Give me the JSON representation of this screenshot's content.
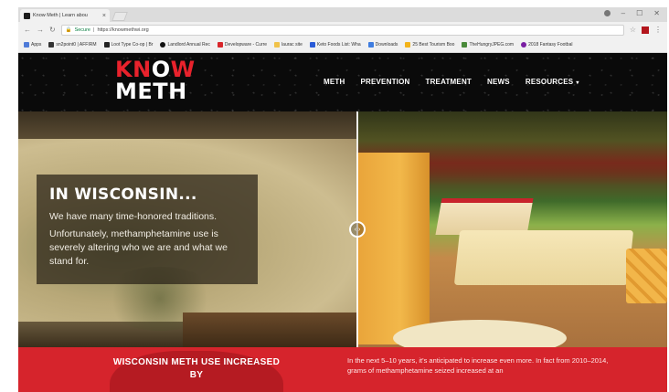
{
  "browser": {
    "tab_title": "Know Meth | Learn abou",
    "tab_close": "×",
    "url_secure": "Secure",
    "url": "https://knowmethwi.org",
    "window_controls": [
      "–",
      "☐",
      "✕"
    ],
    "bookmarks": [
      {
        "label": "Apps",
        "icon": "apps-grid-icon",
        "color": "#4f7bd8"
      },
      {
        "label": "sn2point0 | AFFIRM",
        "icon": "bookmark-site-icon",
        "color": "#333333"
      },
      {
        "label": "Loot Type Co-op | Br",
        "icon": "bookmark-site-icon",
        "color": "#222222"
      },
      {
        "label": "Landlord Annual Rec",
        "icon": "bookmark-site-icon",
        "color": "#111111"
      },
      {
        "label": "Developware - Curre",
        "icon": "bookmark-site-icon",
        "color": "#d8262b"
      },
      {
        "label": "laurac site",
        "icon": "folder-icon",
        "color": "#f0c24a"
      },
      {
        "label": "Keto Foods List: Wha",
        "icon": "bookmark-site-icon",
        "color": "#2a5bd7"
      },
      {
        "label": "Downloads",
        "icon": "download-icon",
        "color": "#3f7de0"
      },
      {
        "label": "25 Best Tourism Boo",
        "icon": "bookmark-site-icon",
        "color": "#f3b31a"
      },
      {
        "label": "TheHungryJPEG.com",
        "icon": "bookmark-site-icon",
        "color": "#4a8a3a"
      },
      {
        "label": "2018 Fantasy Footbal",
        "icon": "bookmark-site-icon",
        "color": "#7a1fa2"
      }
    ]
  },
  "site": {
    "logo_k": "K",
    "logo_n": "N",
    "logo_o": "O",
    "logo_w": "W",
    "logo_line2": "METH",
    "nav": [
      "METH",
      "PREVENTION",
      "TREATMENT",
      "NEWS",
      "RESOURCES"
    ],
    "resources_caret": "▾",
    "hero_title": "IN WISCONSIN...",
    "hero_p1": "We have many time-honored traditions.",
    "hero_p2": "Unfortunately, methamphetamine use is severely altering who we are and what we stand for.",
    "compare_handle": "‹ ›",
    "red_heading": "WISCONSIN METH USE INCREASED BY",
    "red_text": "In the next 5–10 years, it's anticipated to increase even more. In fact from 2010–2014, grams of methamphetamine seized increased at an",
    "colors": {
      "brand_red": "#d6242c",
      "header_bg": "#0a0a0a"
    }
  }
}
